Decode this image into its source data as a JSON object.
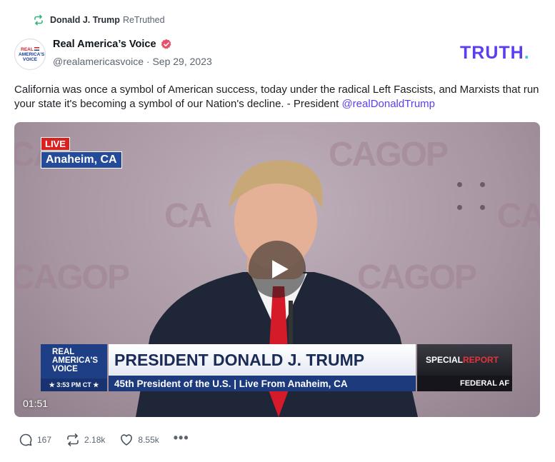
{
  "retruth": {
    "name": "Donald J. Trump",
    "action": "ReTruthed",
    "icon": "retruth-icon"
  },
  "author": {
    "avatar_line1": "REAL",
    "avatar_line2": "AMERICA'S",
    "avatar_line3": "VOICE",
    "name": "Real America’s Voice",
    "handle_and_date": "@realamericasvoice · Sep 29, 2023",
    "verified_icon": "verified-badge-icon"
  },
  "brand": {
    "text": "TRUTH",
    "dot": ".",
    "color": "#5a3ef0"
  },
  "post": {
    "text": "California was once a symbol of American success, today under the radical Left Fascists, and Marxists that run your state it's becoming a symbol of our Nation's decline. - President ",
    "mention": "@realDonaldTrump"
  },
  "video": {
    "live_label": "LIVE",
    "location_label": "Anaheim, CA",
    "bg_logo_left": "CA",
    "bg_logo_right": "CAGOP",
    "chyron": {
      "logo_line1": "REAL",
      "logo_line2": "AMERICA'S",
      "logo_line3": "VOICE",
      "time": "★ 3:53 PM CT ★",
      "title": "PRESIDENT DONALD J. TRUMP",
      "subtitle": "45th President of the U.S. | Live From Anaheim, CA",
      "special_white": "SPECIAL ",
      "special_red": "REPORT",
      "federal": "FEDERAL AF"
    },
    "duration": "01:51",
    "play_icon": "play-icon"
  },
  "actions": {
    "reply_count": "167",
    "retruth_count": "2.18k",
    "like_count": "8.55k",
    "more_label": "•••"
  }
}
